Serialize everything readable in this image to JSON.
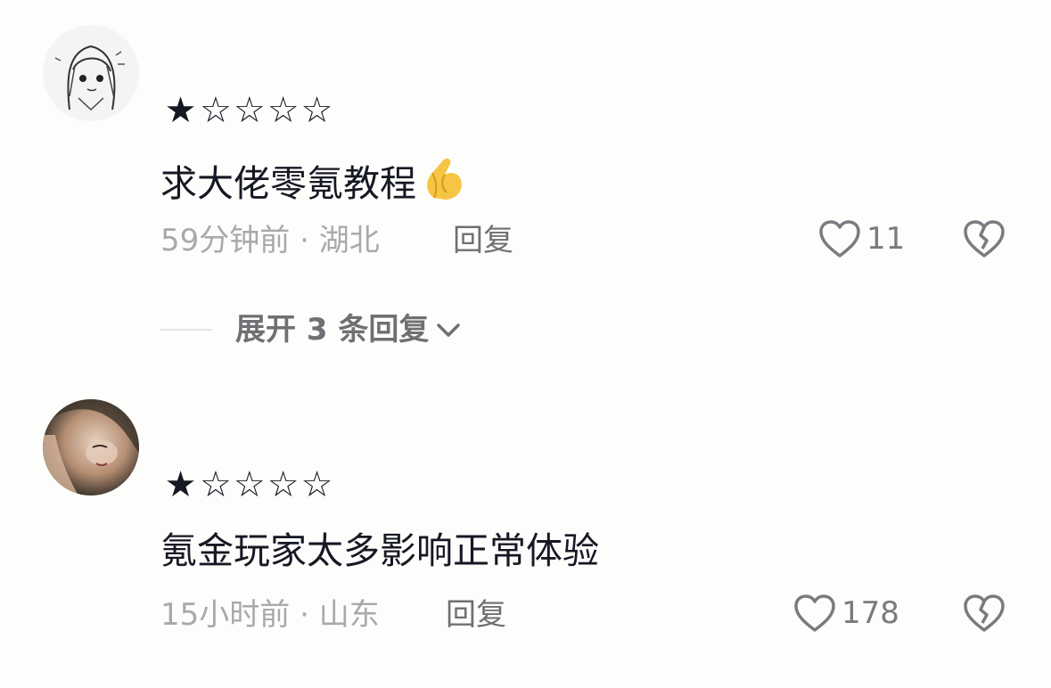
{
  "comments": [
    {
      "rating_full": "★",
      "rating_empty": "☆☆☆☆",
      "text": "求大佬零氪教程",
      "time": "59分钟前",
      "separator": "·",
      "location": "湖北",
      "reply_label": "回复",
      "likes": "11",
      "emoji": "pinched-hands-emoji"
    },
    {
      "rating_full": "★",
      "rating_empty": "☆☆☆☆",
      "text": "氪金玩家太多影响正常体验",
      "time": "15小时前",
      "separator": "·",
      "location": "山东",
      "reply_label": "回复",
      "likes": "178"
    }
  ],
  "expand_replies": {
    "label": "展开 3 条回复"
  },
  "colors": {
    "text": "#161823",
    "meta": "#a9a9ad",
    "action": "#6f6f74",
    "background": "#fdfdfc"
  },
  "icons": [
    "heart-outline-icon",
    "broken-heart-icon",
    "chevron-down-icon"
  ]
}
